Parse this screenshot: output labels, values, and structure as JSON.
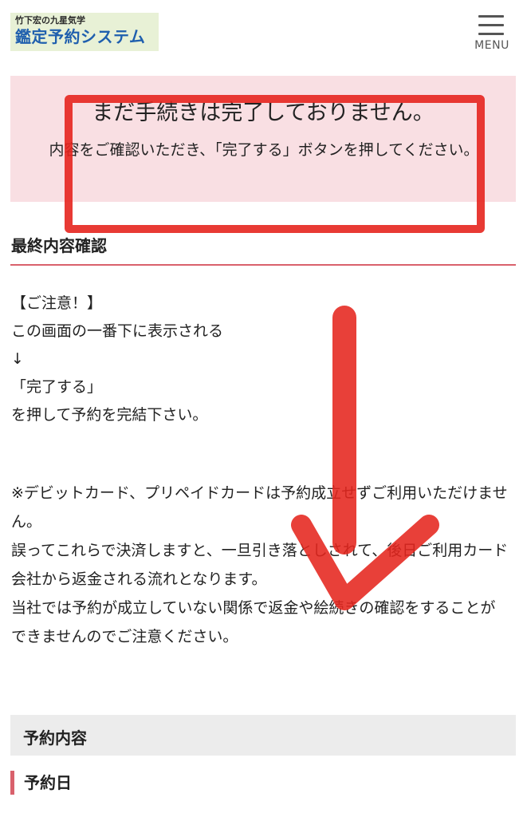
{
  "header": {
    "logo_sub": "竹下宏の九星気学",
    "logo_main": "鑑定予約システム",
    "menu_label": "MENU"
  },
  "notice": {
    "title": "まだ手続きは完了しておりません。",
    "body": "内容をご確認いただき、「完了する」ボタンを押してください。"
  },
  "section": {
    "title": "最終内容確認"
  },
  "caution": {
    "lines": [
      "【ご注意！】",
      "この画面の一番下に表示される",
      "↓",
      "「完了する」",
      "を押して予約を完結下さい。"
    ]
  },
  "debit": {
    "paragraphs": [
      "※デビットカード、プリペイドカードは予約成立せずご利用いただけません。",
      "誤ってこれらで決済しますと、一旦引き落としされて、後日ご利用カード会社から返金される流れとなります。",
      "当社では予約が成立していない関係で返金や絵続きの確認をすることができませんのでご注意ください。"
    ]
  },
  "reservation": {
    "header": "予約内容",
    "date_label": "予約日"
  },
  "colors": {
    "notice_bg": "#f9dfe3",
    "accent_red": "#d9616c",
    "annotation_red": "#e5251e",
    "logo_blue": "#1f5fae",
    "section_bar_bg": "#ececec"
  }
}
